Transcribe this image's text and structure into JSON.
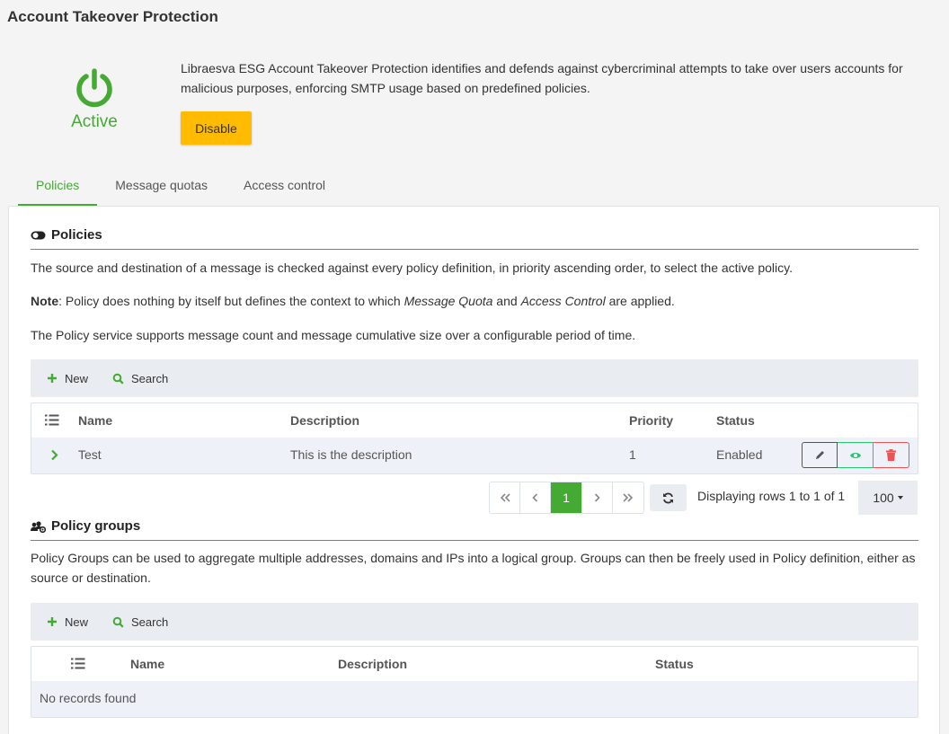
{
  "page": {
    "title": "Account Takeover Protection",
    "status": "Active",
    "description": "Libraesva ESG Account Takeover Protection identifies and defends against cybercriminal attempts to take over users accounts for malicious purposes, enforcing SMTP usage based on predefined policies.",
    "disable_label": "Disable"
  },
  "tabs": [
    {
      "label": "Policies",
      "active": true
    },
    {
      "label": "Message quotas",
      "active": false
    },
    {
      "label": "Access control",
      "active": false
    }
  ],
  "policies": {
    "heading": "Policies",
    "para1": "The source and destination of a message is checked against every policy definition, in priority ascending order, to select the active policy.",
    "note_label": "Note",
    "note_part1": ": Policy does nothing by itself but defines the context to which ",
    "note_em1": "Message Quota",
    "note_part2": " and ",
    "note_em2": "Access Control",
    "note_part3": " are applied.",
    "para3": "The Policy service supports message count and message cumulative size over a configurable period of time.",
    "toolbar": {
      "new_label": "New",
      "search_label": "Search"
    },
    "columns": {
      "name": "Name",
      "description": "Description",
      "priority": "Priority",
      "status": "Status"
    },
    "rows": [
      {
        "name": "Test",
        "description": "This is the description",
        "priority": "1",
        "status": "Enabled"
      }
    ],
    "pagination": {
      "current_page": "1",
      "rows_info": "Displaying rows 1 to 1 of 1",
      "page_size": "100"
    }
  },
  "policy_groups": {
    "heading": "Policy groups",
    "para": "Policy Groups can be used to aggregate multiple addresses, domains and IPs into a logical group. Groups can then be freely used in Policy definition, either as source or destination.",
    "toolbar": {
      "new_label": "New",
      "search_label": "Search"
    },
    "columns": {
      "name": "Name",
      "description": "Description",
      "status": "Status"
    },
    "empty_message": "No records found"
  },
  "colors": {
    "accent_green": "#44aa33",
    "disable_button": "#ffbb00",
    "view_action": "#28c76f",
    "delete_action": "#ea5455"
  },
  "icons": [
    "power-icon",
    "toggle-icon",
    "list-icon",
    "chevron-right-icon",
    "plus-icon",
    "search-icon",
    "pencil-icon",
    "eye-icon",
    "trash-icon",
    "first-page-icon",
    "prev-page-icon",
    "next-page-icon",
    "last-page-icon",
    "refresh-icon",
    "users-cog-icon"
  ]
}
